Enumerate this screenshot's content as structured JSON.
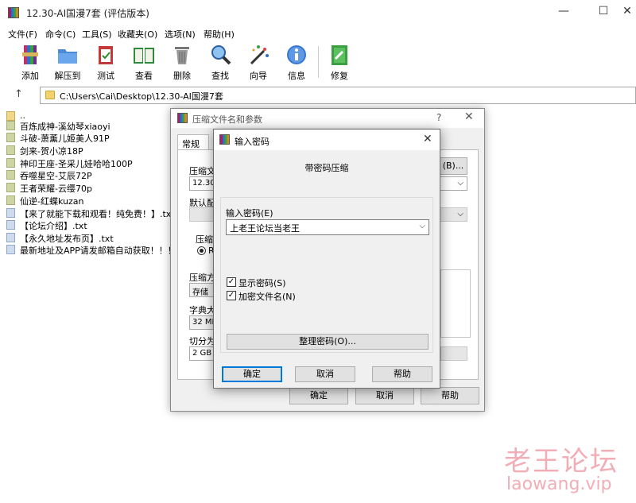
{
  "window": {
    "title": "12.30-AI国漫7套 (评估版本)",
    "controls": {
      "minimize": "—",
      "maximize": "☐",
      "close": "✕"
    }
  },
  "menu": [
    "文件(F)",
    "命令(C)",
    "工具(S)",
    "收藏夹(O)",
    "选项(N)",
    "帮助(H)"
  ],
  "toolbar": [
    {
      "label": "添加",
      "icon": "add-archive-icon"
    },
    {
      "label": "解压到",
      "icon": "extract-folder-icon"
    },
    {
      "label": "测试",
      "icon": "test-clipboard-icon"
    },
    {
      "label": "查看",
      "icon": "view-book-icon"
    },
    {
      "label": "删除",
      "icon": "delete-trash-icon"
    },
    {
      "label": "查找",
      "icon": "find-magnifier-icon"
    },
    {
      "label": "向导",
      "icon": "wizard-wand-icon"
    },
    {
      "label": "信息",
      "icon": "info-icon"
    },
    {
      "label": "修复",
      "icon": "repair-icon"
    }
  ],
  "address": {
    "path": "C:\\Users\\Cai\\Desktop\\12.30-AI国漫7套",
    "up": "↑"
  },
  "files": [
    {
      "name": "..",
      "type": "up"
    },
    {
      "name": "百炼成神-溪幼琴xiaoyi",
      "type": "folder"
    },
    {
      "name": "斗破-萧薰儿姬美人91P",
      "type": "folder"
    },
    {
      "name": "剑来-贺小凉18P",
      "type": "folder"
    },
    {
      "name": "神印王座-圣采儿娃哈哈100P",
      "type": "folder"
    },
    {
      "name": "吞噬星空-艾辰72P",
      "type": "folder"
    },
    {
      "name": "王者荣耀-云缨70p",
      "type": "folder"
    },
    {
      "name": "仙逆-红蝶kuzan",
      "type": "folder"
    },
    {
      "name": "【来了就能下载和观看！纯免费！】.txt",
      "type": "txt"
    },
    {
      "name": "【论坛介绍】.txt",
      "type": "txt"
    },
    {
      "name": "【永久地址发布页】.txt",
      "type": "txt"
    },
    {
      "name": "最新地址及APP请发邮箱自动获取！！！.t",
      "type": "txt"
    }
  ],
  "archive_dialog": {
    "title": "压缩文件名和参数",
    "help": "?",
    "close": "✕",
    "tab_general": "常规",
    "archive_name_label": "压缩文",
    "archive_name_value": "12.30-",
    "browse_button": "(B)...",
    "default_profile_label": "默认配",
    "format_label": "压缩",
    "format_radio": "RA",
    "method_label": "压缩方",
    "method_value": "存储",
    "dict_label": "字典大",
    "dict_value": "32 MB",
    "split_label": "切分为",
    "split_value": "2 GB",
    "ok": "确定",
    "cancel": "取消",
    "help_button": "帮助"
  },
  "password_dialog": {
    "title": "输入密码",
    "close": "✕",
    "heading": "带密码压缩",
    "password_label": "输入密码(E)",
    "password_value": "上老王论坛当老王",
    "show_password_label": "显示密码(S)",
    "show_password_checked": true,
    "encrypt_names_label": "加密文件名(N)",
    "encrypt_names_checked": true,
    "manage_button": "整理密码(O)...",
    "ok": "确定",
    "cancel": "取消",
    "help": "帮助"
  },
  "watermark": {
    "zh": "老王论坛",
    "en": "laowang.vip"
  }
}
